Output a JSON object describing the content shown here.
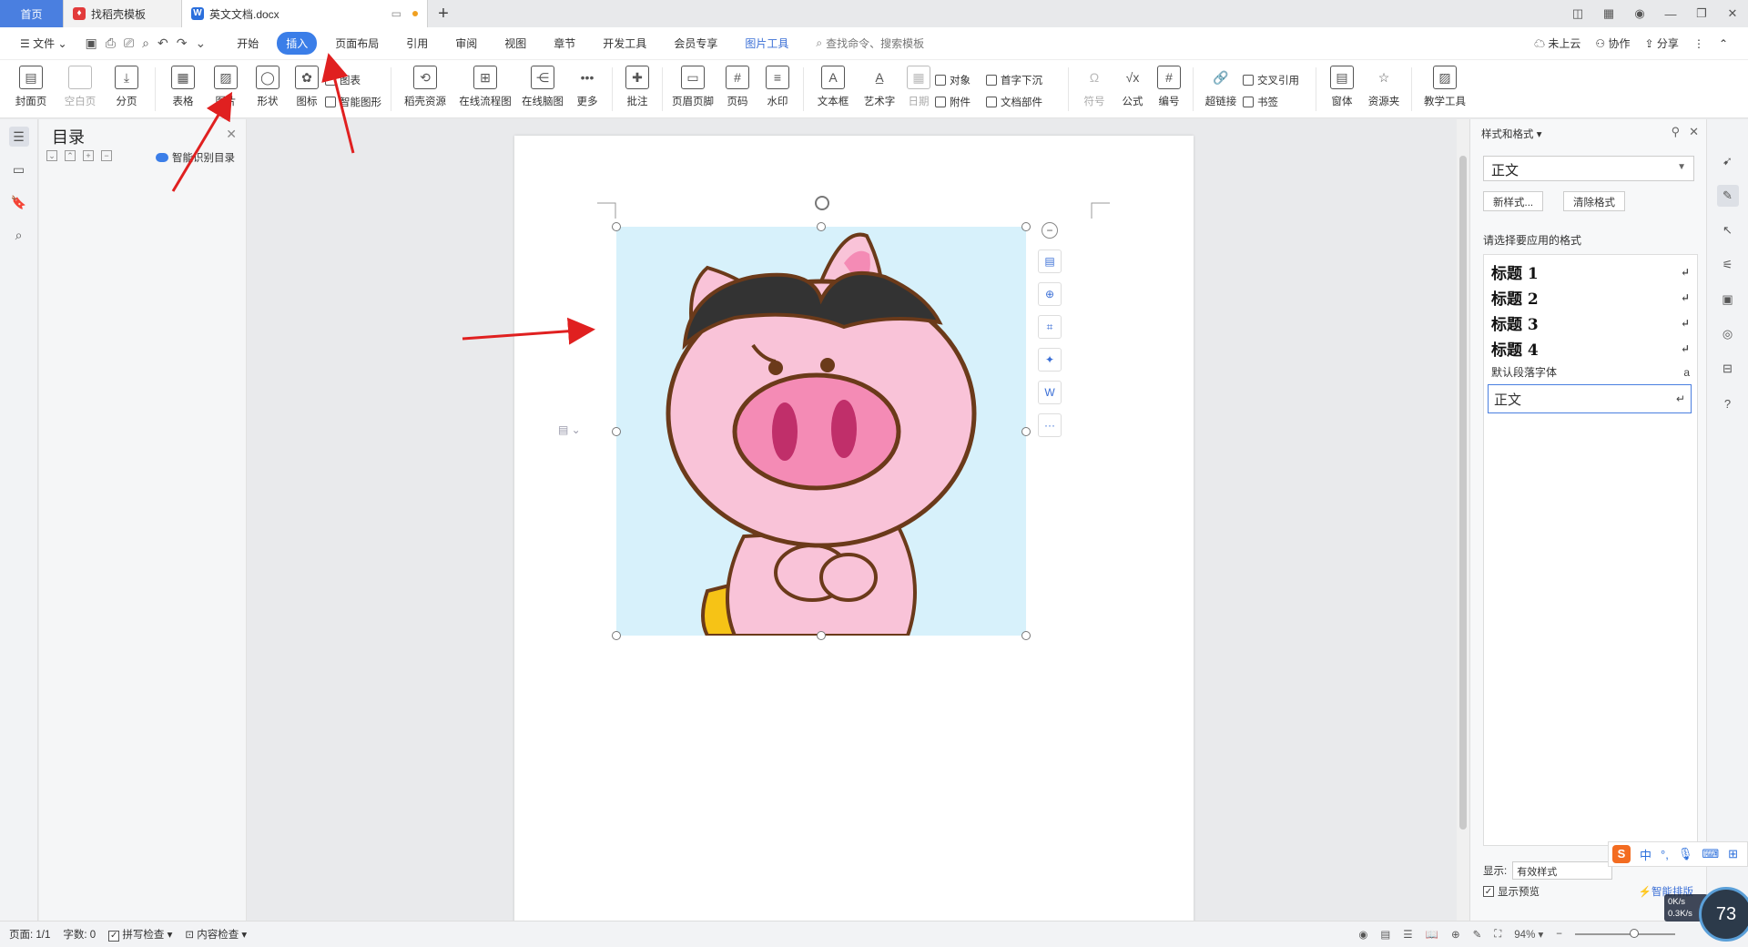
{
  "tabs": {
    "home": "首页",
    "template": "找稻壳模板",
    "doc": "英文文档.docx",
    "new_tab": "+"
  },
  "menu": {
    "file": "文件",
    "items": [
      "开始",
      "插入",
      "页面布局",
      "引用",
      "审阅",
      "视图",
      "章节",
      "开发工具",
      "会员专享"
    ],
    "active_index": 1,
    "picture_tools": "图片工具",
    "search": "查找命令、搜索模板",
    "right": [
      "未上云",
      "协作",
      "分享"
    ]
  },
  "ribbon": {
    "cover": "封面页",
    "blank": "空白页",
    "break": "分页",
    "table": "表格",
    "picture": "图片",
    "shape": "形状",
    "icon": "图标",
    "chart": "图表",
    "smart_shape": "智能图形",
    "docer": "稻壳资源",
    "flowchart": "在线流程图",
    "mindmap": "在线脑图",
    "more": "更多",
    "comment": "批注",
    "header_footer": "页眉页脚",
    "page_num": "页码",
    "watermark": "水印",
    "textbox": "文本框",
    "wordart": "艺术字",
    "date": "日期",
    "object": "对象",
    "attachment": "附件",
    "drop_cap": "首字下沉",
    "doc_parts": "文档部件",
    "symbol": "符号",
    "formula": "公式",
    "numbering": "编号",
    "hyperlink": "超链接",
    "cross_ref": "交叉引用",
    "bookmark": "书签",
    "window": "窗体",
    "resource": "资源夹",
    "teaching": "教学工具"
  },
  "toc": {
    "title": "目录",
    "smart": "智能识别目录"
  },
  "style_panel": {
    "title": "样式和格式",
    "current_style": "正文",
    "new_style": "新样式...",
    "clear_format": "清除格式",
    "choose_label": "请选择要应用的格式",
    "items": [
      "标题 1",
      "标题 2",
      "标题 3",
      "标题 4",
      "默认段落字体",
      "正文"
    ],
    "show_label": "显示:",
    "show_value": "有效样式",
    "preview_label": "显示预览",
    "smart_layout": "智能排版"
  },
  "status": {
    "page": "页面: 1/1",
    "words": "字数: 0",
    "spell": "拼写检查",
    "content_check": "内容检查",
    "zoom": "94%"
  },
  "ime": {
    "lang": "中"
  },
  "speed": {
    "up": "0K/s",
    "down": "0.3K/s",
    "value": "73"
  },
  "colors": {
    "accent": "#3b7ee8",
    "arrow": "#e02020",
    "pig_body": "#f9c3d8",
    "image_bg": "#d7f1fb"
  }
}
